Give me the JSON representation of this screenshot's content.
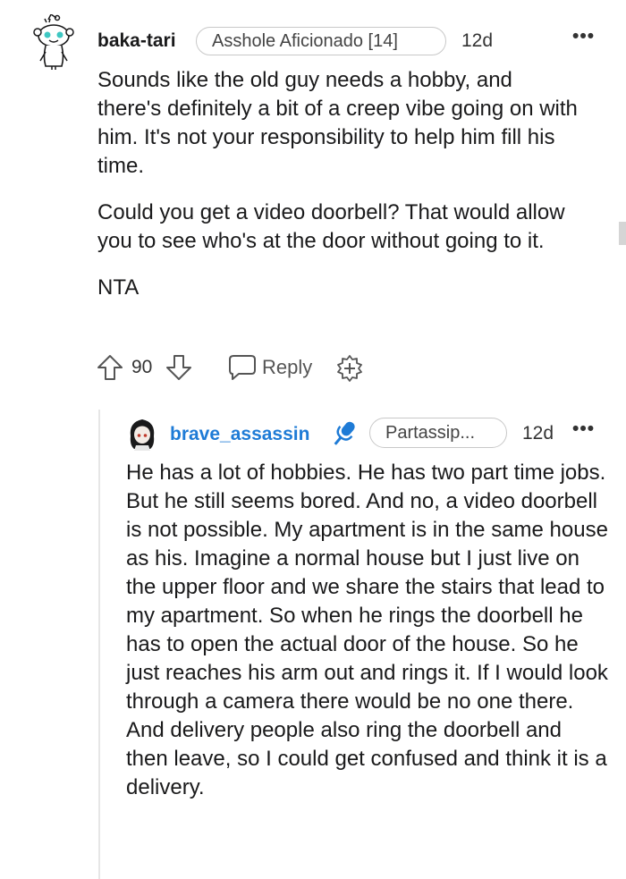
{
  "comment": {
    "username": "baka-tari",
    "flair": "Asshole Aficionado [14]",
    "time": "12d",
    "more": "•••",
    "paragraphs": [
      "Sounds like the old guy needs a hobby, and there's definitely a bit of a creep vibe going on with him. It's not your responsibility to help him fill his time.",
      "Could you get a video doorbell? That would allow you to see who's at the door without going to it.",
      "NTA"
    ],
    "score": "90",
    "reply_label": "Reply"
  },
  "reply": {
    "username": "brave_assassin",
    "flair": "Partassip...",
    "time": "12d",
    "more": "•••",
    "text": "He has a lot of hobbies. He has two part time jobs. But he still seems bored. And no, a video doorbell is not possible. My apartment is in the same house as his. Imagine a normal house but I just live on the upper floor and we share the stairs that lead to my apartment. So when he rings the doorbell he has to open the actual door of the house. So he just reaches his arm out and rings it. If I would look through a camera there would be no one there. And delivery people also ring the doorbell and then leave, so I could get confused and think it is a delivery."
  },
  "icons": {
    "avatar": "snoo-avatar-icon",
    "reply_avatar": "anime-avatar-icon",
    "upvote": "upvote-arrow-icon",
    "downvote": "downvote-arrow-icon",
    "reply": "speech-bubble-icon",
    "award": "award-plus-icon",
    "badge": "microphone-icon"
  },
  "colors": {
    "username_reply": "#1e7bd6",
    "badge_blue": "#1e7bd6",
    "text": "#1a1a1b",
    "snoo_accent": "#3ec7c2"
  }
}
